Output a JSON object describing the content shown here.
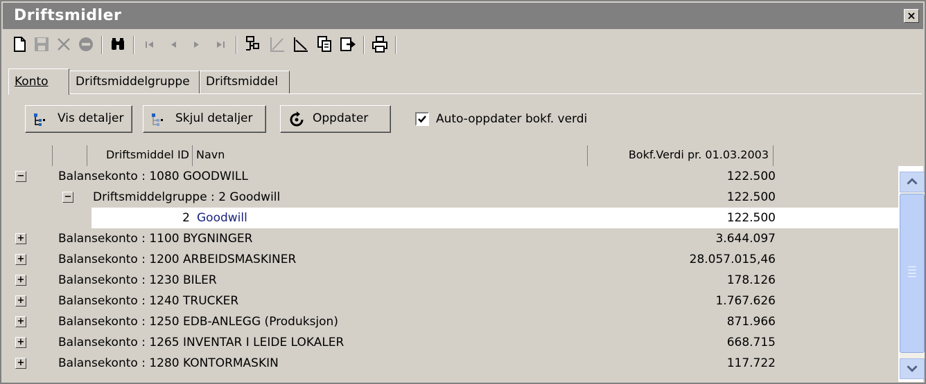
{
  "window": {
    "title": "Driftsmidler",
    "close_label": "×"
  },
  "toolbar": {
    "items": [
      {
        "icon": "new-document-icon"
      },
      {
        "icon": "save-icon"
      },
      {
        "icon": "delete-x-icon"
      },
      {
        "icon": "cancel-icon"
      },
      {
        "icon": "binoculars-icon"
      },
      {
        "icon": "first-record-icon"
      },
      {
        "icon": "previous-record-icon"
      },
      {
        "icon": "next-record-icon"
      },
      {
        "icon": "last-record-icon"
      },
      {
        "icon": "add-subitem-icon"
      },
      {
        "icon": "depreciation-up-icon"
      },
      {
        "icon": "depreciation-down-icon"
      },
      {
        "icon": "copy-icon"
      },
      {
        "icon": "export-icon"
      },
      {
        "icon": "print-icon"
      }
    ]
  },
  "tabs": [
    {
      "label": "Konto",
      "active": true
    },
    {
      "label": "Driftsmiddelgruppe",
      "active": false
    },
    {
      "label": "Driftsmiddel",
      "active": false
    }
  ],
  "actions": {
    "show_details": "Vis detaljer",
    "hide_details": "Skjul detaljer",
    "refresh": "Oppdater",
    "auto_update_label": "Auto-oppdater bokf. verdi",
    "auto_update_checked": true
  },
  "grid": {
    "columns": [
      "Driftsmiddel ID",
      "Navn",
      "Bokf.Verdi pr. 01.03.2003"
    ],
    "rows": [
      {
        "level": 0,
        "expander": "−",
        "label": "Balansekonto : 1080  GOODWILL",
        "value": "122.500"
      },
      {
        "level": 1,
        "expander": "−",
        "label": "Driftsmiddelgruppe : 2  Goodwill",
        "value": "122.500"
      },
      {
        "level": 2,
        "id": "2",
        "name": "Goodwill",
        "value": "122.500",
        "selected": true
      },
      {
        "level": 0,
        "expander": "+",
        "label": "Balansekonto : 1100  BYGNINGER",
        "value": "3.644.097"
      },
      {
        "level": 0,
        "expander": "+",
        "label": "Balansekonto : 1200  ARBEIDSMASKINER",
        "value": "28.057.015,46"
      },
      {
        "level": 0,
        "expander": "+",
        "label": "Balansekonto : 1230  BILER",
        "value": "178.126"
      },
      {
        "level": 0,
        "expander": "+",
        "label": "Balansekonto : 1240  TRUCKER",
        "value": "1.767.626"
      },
      {
        "level": 0,
        "expander": "+",
        "label": "Balansekonto : 1250  EDB-ANLEGG (Produksjon)",
        "value": "871.966"
      },
      {
        "level": 0,
        "expander": "+",
        "label": "Balansekonto : 1265  INVENTAR I LEIDE LOKALER",
        "value": "668.715"
      },
      {
        "level": 0,
        "expander": "+",
        "label": "Balansekonto : 1280  KONTORMASKIN",
        "value": "117.722"
      }
    ]
  },
  "colors": {
    "titlebar": "#808080",
    "face": "#d4d0c8",
    "scroll_accent": "#bcd0f8",
    "link_text": "#1a237e"
  }
}
